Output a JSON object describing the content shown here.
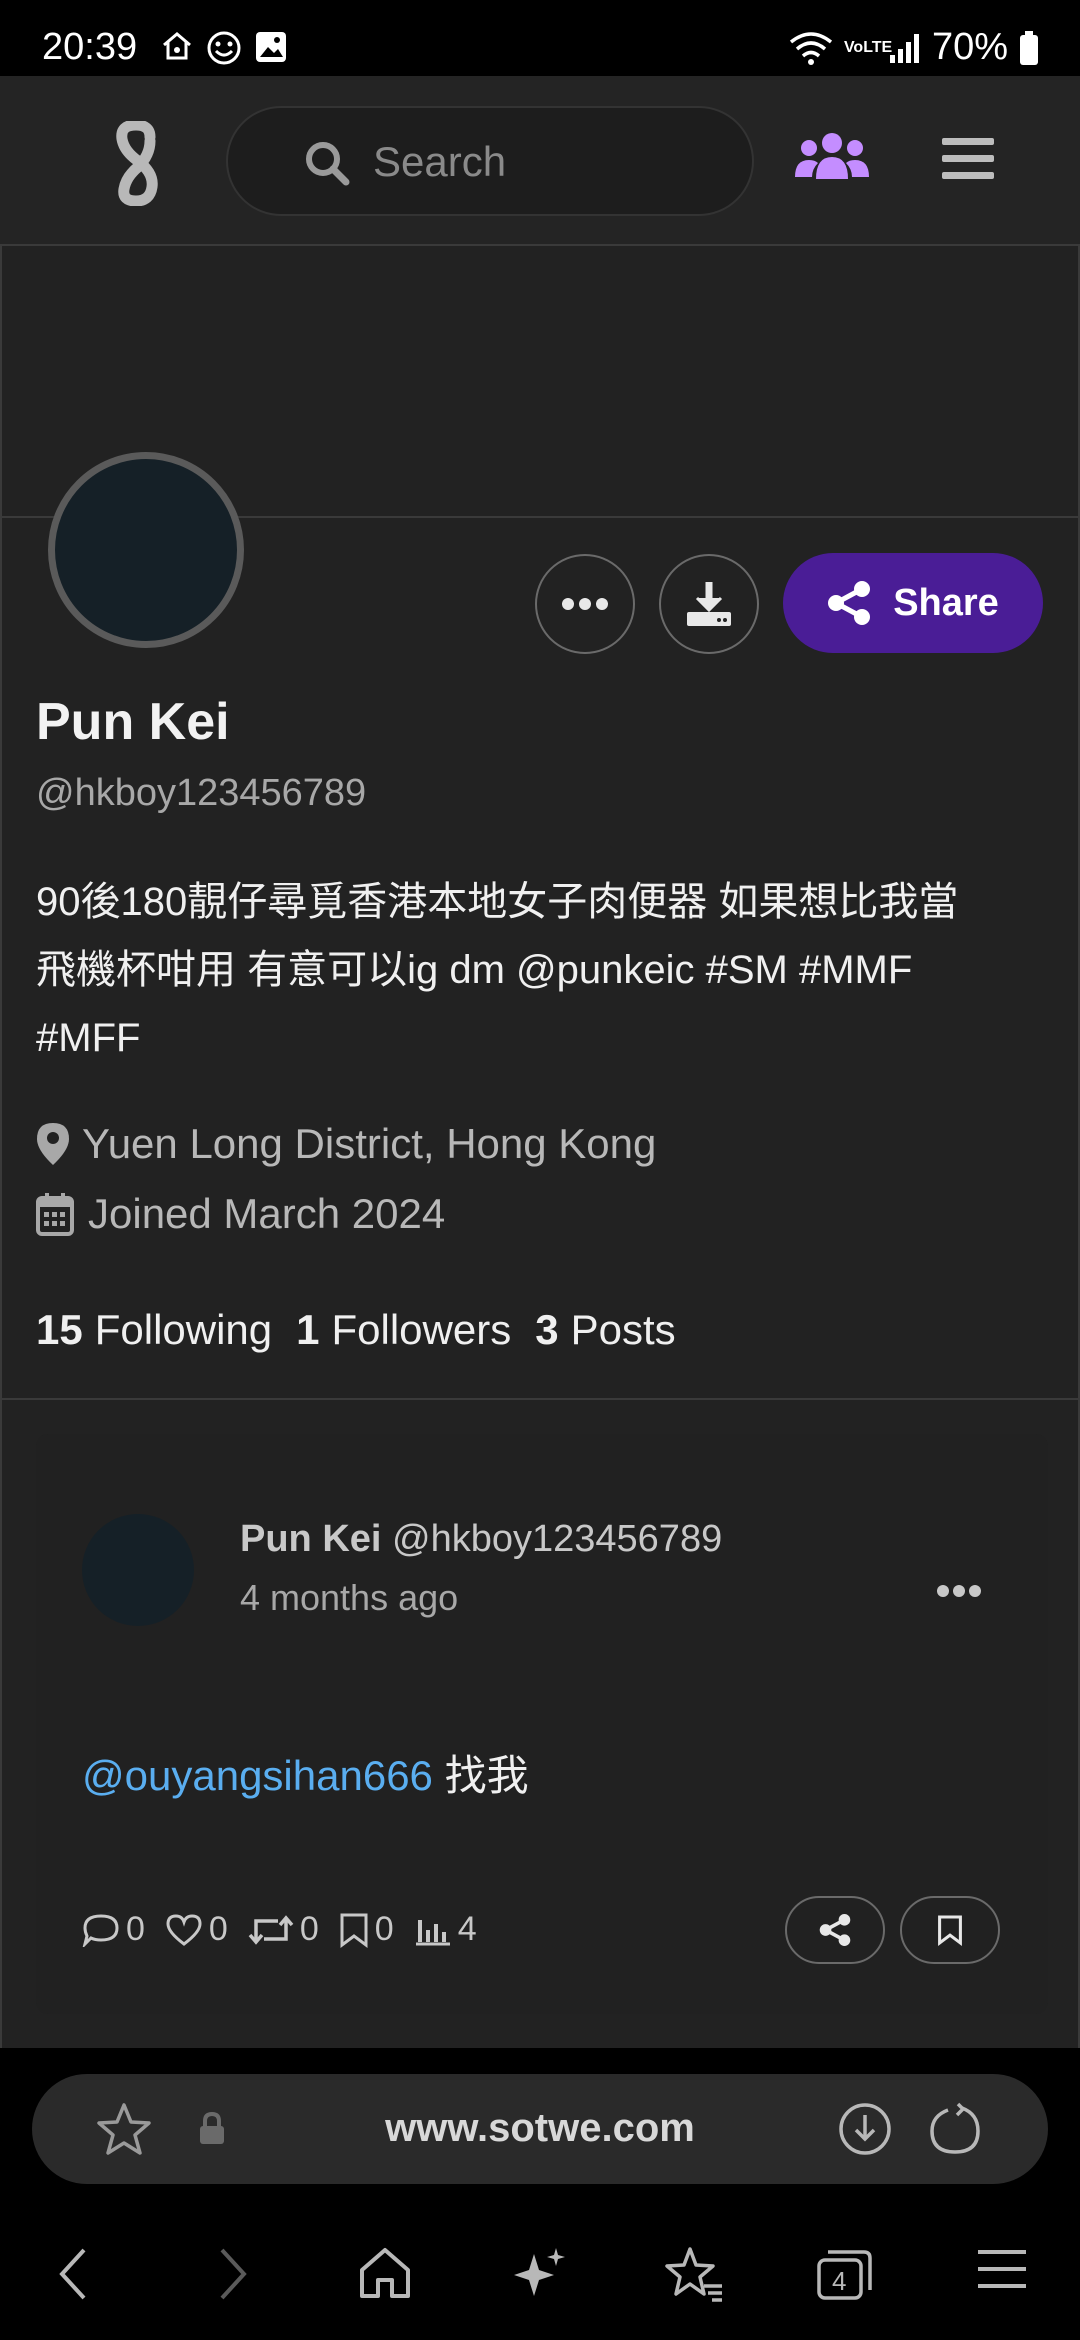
{
  "status_bar": {
    "time": "20:39",
    "network": "VoLTE",
    "battery": "70%",
    "icons": [
      "home-icon",
      "smiley-icon",
      "gallery-icon",
      "wifi-icon",
      "signal-icon",
      "battery-icon"
    ]
  },
  "header": {
    "logo": "sotwe-logo-icon",
    "search_placeholder": "Search",
    "people_icon": "people-icon",
    "menu_icon": "hamburger-menu-icon",
    "accent_color": "#c48dff"
  },
  "profile": {
    "name": "Pun Kei",
    "handle": "@hkboy123456789",
    "bio_line1": "90後180靚仔尋覓香港本地女子肉便器 如果想比我當",
    "bio_line2": "飛機杯咁用 有意可以ig dm @punkeic #SM #MMF",
    "bio_line3": "#MFF",
    "location": "Yuen Long District, Hong Kong",
    "joined": "Joined March 2024",
    "following_count": "15",
    "following_label": "Following",
    "followers_count": "1",
    "followers_label": "Followers",
    "posts_count": "3",
    "posts_label": "Posts",
    "share_label": "Share",
    "share_color": "#4a1d96"
  },
  "post": {
    "author_name": "Pun Kei",
    "author_handle": "@hkboy123456789",
    "time": "4 months ago",
    "mention": "@ouyangsihan666",
    "text": "找我",
    "replies": "0",
    "likes": "0",
    "retweets": "0",
    "bookmarks": "0",
    "views": "4"
  },
  "browser": {
    "url": "www.sotwe.com",
    "tab_count": "4"
  }
}
